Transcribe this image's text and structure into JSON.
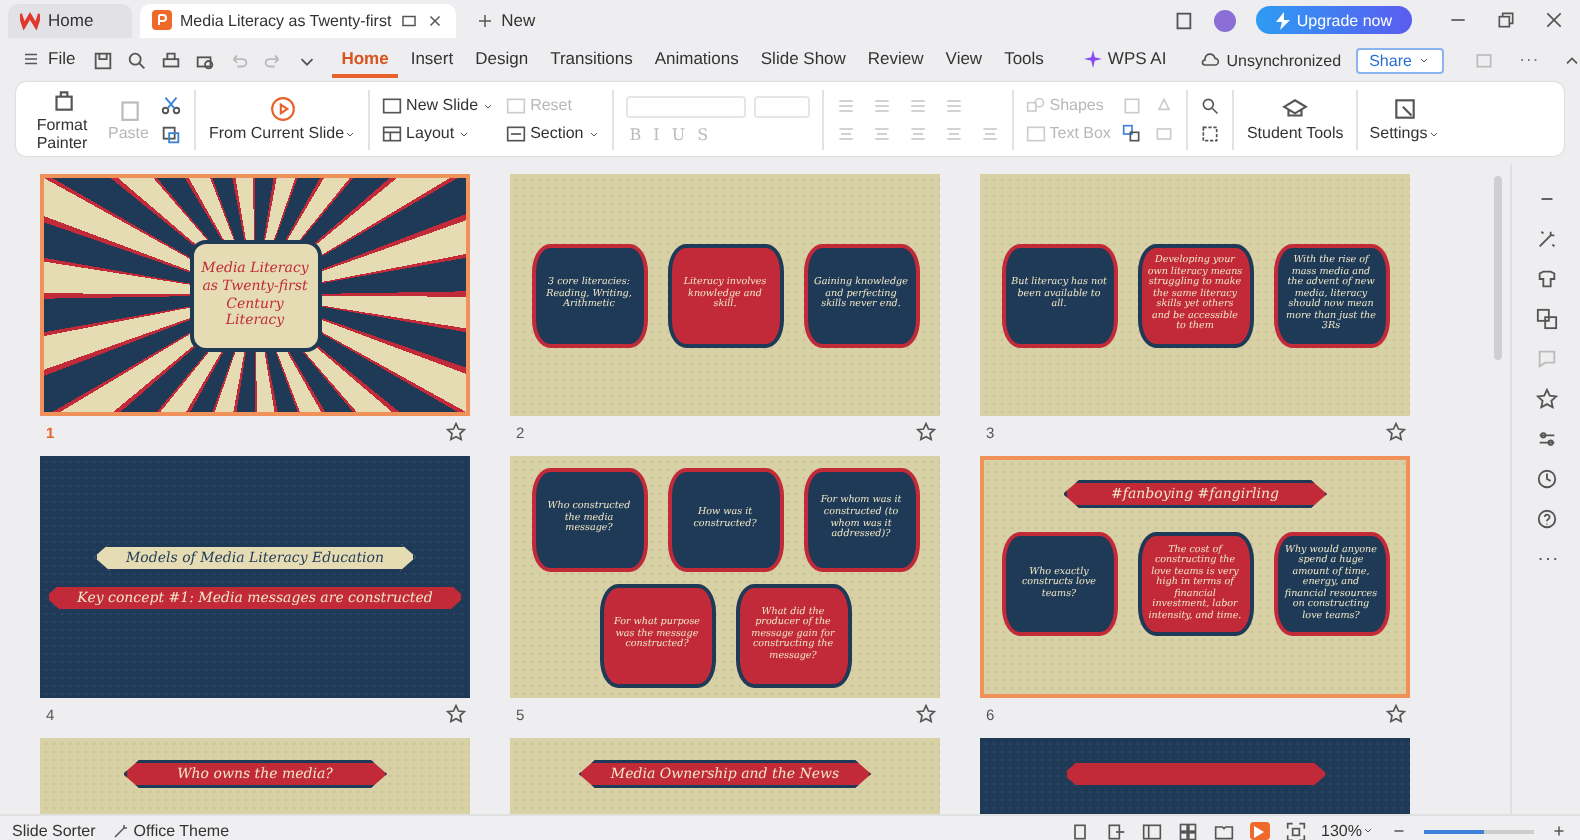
{
  "window": {
    "tabs": [
      {
        "kind": "home",
        "label": "Home",
        "selected": false
      },
      {
        "kind": "document",
        "label": "Media Literacy as Twenty-first",
        "selected": true
      }
    ],
    "new_tab": "New",
    "upgrade": "Upgrade now"
  },
  "menu": {
    "file": "File",
    "tabs": [
      {
        "label": "Home",
        "selected": true
      },
      {
        "label": "Insert",
        "selected": false
      },
      {
        "label": "Design",
        "selected": false
      },
      {
        "label": "Transitions",
        "selected": false
      },
      {
        "label": "Animations",
        "selected": false
      },
      {
        "label": "Slide Show",
        "selected": false
      },
      {
        "label": "Review",
        "selected": false
      },
      {
        "label": "View",
        "selected": false
      },
      {
        "label": "Tools",
        "selected": false
      }
    ],
    "ai": "WPS AI",
    "sync": "Unsynchronized",
    "share": "Share"
  },
  "ribbon": {
    "format_painter": "Format Painter",
    "paste": {
      "label": "Paste",
      "disabled": true
    },
    "from_current_slide": "From Current Slide",
    "new_slide": "New Slide",
    "reset": {
      "label": "Reset",
      "disabled": true
    },
    "layout": "Layout",
    "section": "Section",
    "text_format": [
      {
        "label": "B",
        "disabled": true
      },
      {
        "label": "I",
        "disabled": true
      },
      {
        "label": "U",
        "disabled": true
      },
      {
        "label": "S",
        "disabled": true
      }
    ],
    "shapes": {
      "label": "Shapes",
      "disabled": true
    },
    "text_box": {
      "label": "Text Box",
      "disabled": true
    },
    "student_tools": "Student Tools",
    "settings": "Settings"
  },
  "slides": [
    {
      "number": "1",
      "selected": true,
      "current": true,
      "kind": "sunburst",
      "shapes": [
        {
          "kind": "frame",
          "color": "#e6dcb4",
          "text": "Media Literacy as Twenty-first Century Literacy"
        }
      ]
    },
    {
      "number": "2",
      "selected": false,
      "current": false,
      "kind": "tan",
      "shapes": [
        {
          "kind": "card",
          "color": "#1f3a57",
          "text": "3 core literacies: Reading, Writing, Arithmetic"
        },
        {
          "kind": "card",
          "color": "#c22a3a",
          "text": "Literacy involves knowledge and skill."
        },
        {
          "kind": "card",
          "color": "#1f3a57",
          "text": "Gaining knowledge and perfecting skills never end."
        }
      ]
    },
    {
      "number": "3",
      "selected": false,
      "current": false,
      "kind": "tan",
      "shapes": [
        {
          "kind": "card",
          "color": "#1f3a57",
          "text": "But literacy has not been available to all."
        },
        {
          "kind": "card",
          "color": "#c22a3a",
          "text": "Developing your own literacy means struggling to make the same literacy skills yet others and be accessible to them"
        },
        {
          "kind": "card",
          "color": "#1f3a57",
          "text": "With the rise of mass media and the advent of new media, literacy should now mean more than just the 3Rs"
        }
      ]
    },
    {
      "number": "4",
      "selected": false,
      "current": false,
      "kind": "navy",
      "shapes": [
        {
          "kind": "banner",
          "color": "#e6dcb4",
          "text": "Models of Media Literacy Education"
        },
        {
          "kind": "banner",
          "color": "#c22a3a",
          "text": "Key concept #1: Media messages are constructed"
        }
      ]
    },
    {
      "number": "5",
      "selected": false,
      "current": false,
      "kind": "tan",
      "shapes": [
        {
          "kind": "card",
          "color": "#1f3a57",
          "text": "Who constructed the media message?"
        },
        {
          "kind": "card",
          "color": "#1f3a57",
          "text": "How was it constructed?"
        },
        {
          "kind": "card",
          "color": "#1f3a57",
          "text": "For whom was it constructed (to whom was it addressed)?"
        },
        {
          "kind": "card",
          "color": "#c22a3a",
          "text": "For what purpose was the message constructed?"
        },
        {
          "kind": "card",
          "color": "#c22a3a",
          "text": "What did the producer of the message gain for constructing the message?"
        }
      ]
    },
    {
      "number": "6",
      "selected": true,
      "current": false,
      "kind": "tan",
      "shapes": [
        {
          "kind": "banner",
          "color": "#c22a3a",
          "text": "#fanboying #fangirling"
        },
        {
          "kind": "card",
          "color": "#1f3a57",
          "text": "Who exactly constructs love teams?"
        },
        {
          "kind": "card",
          "color": "#c22a3a",
          "text": "The cost of constructing the love teams is very high in terms of financial investment, labor intensity, and time."
        },
        {
          "kind": "card",
          "color": "#1f3a57",
          "text": "Why would anyone spend a huge amount of time, energy, and financial resources on constructing love teams?"
        }
      ]
    },
    {
      "selected": false,
      "kind": "tan",
      "shapes": [
        {
          "kind": "banner",
          "color": "#c22a3a",
          "text": "Who owns the media?"
        }
      ]
    },
    {
      "selected": false,
      "kind": "tan",
      "shapes": [
        {
          "kind": "banner",
          "color": "#c22a3a",
          "text": "Media Ownership and the News"
        }
      ]
    },
    {
      "selected": false,
      "kind": "navy",
      "shapes": [
        {
          "kind": "banner",
          "color": "#c22a3a"
        }
      ]
    }
  ],
  "status_bar": {
    "view": "Slide Sorter",
    "theme": "Office Theme",
    "zoom": "130%",
    "zoom_slider": {
      "level": 0.55
    }
  }
}
